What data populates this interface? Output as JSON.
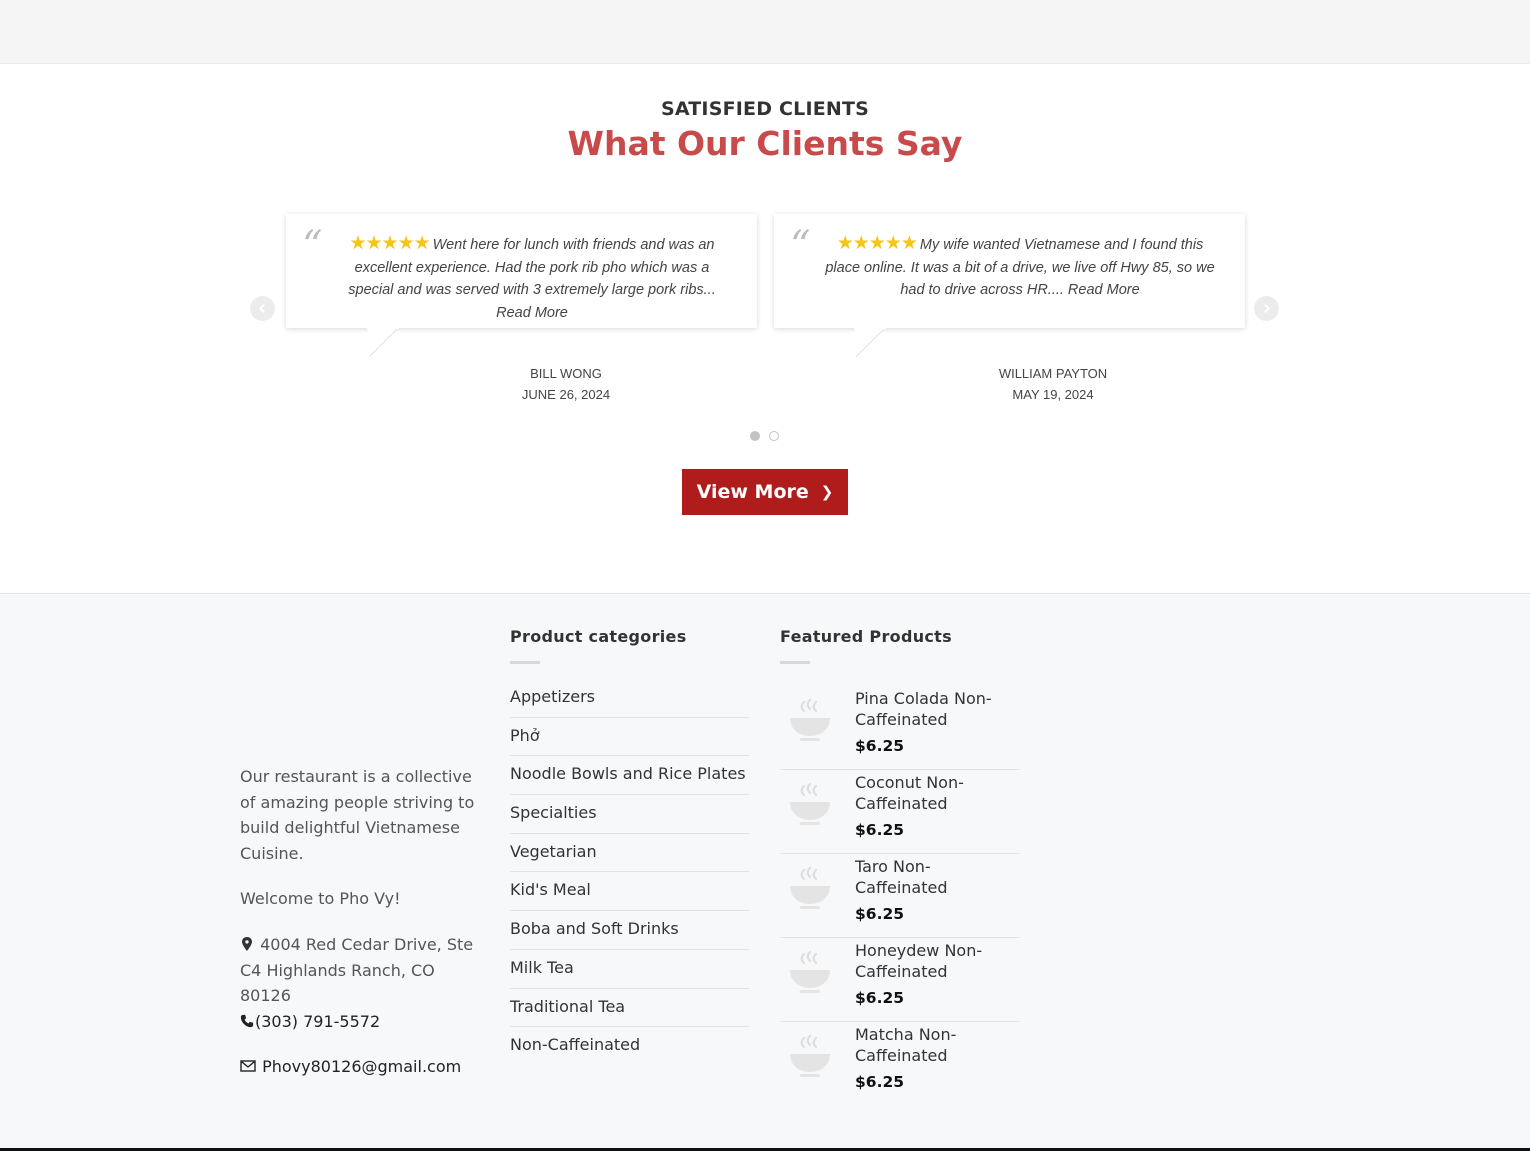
{
  "testimonials": {
    "eyebrow": "SATISFIED CLIENTS",
    "heading": "What Our Clients Say",
    "reviews": [
      {
        "stars": "★★★★★",
        "rating": 5,
        "text": "Went here for lunch with friends and was an excellent experience. Had the pork rib pho which was a special and was served with 3 extremely large pork ribs... Read More",
        "author": "BILL WONG",
        "date": "JUNE 26, 2024"
      },
      {
        "stars": "★★★★★",
        "rating": 5,
        "text": "My wife wanted Vietnamese and I found this place online. It was a bit of a drive, we live off Hwy 85, so we had to drive across HR.... Read More",
        "author": "WILLIAM PAYTON",
        "date": "MAY 19, 2024"
      }
    ],
    "carousel": {
      "pages": 2,
      "active_page": 1
    },
    "view_more_label": "View More"
  },
  "footer": {
    "about": {
      "description": "Our restaurant is a collective of amazing people striving to build delightful Vietnamese Cuisine.",
      "welcome": "Welcome to Pho Vy!",
      "address": "4004 Red Cedar Drive, Ste C4 Highlands Ranch, CO 80126",
      "phone": "(303) 791-5572",
      "email": "Phovy80126@gmail.com"
    },
    "categories": {
      "title": "Product categories",
      "items": [
        "Appetizers",
        "Phở",
        "Noodle Bowls and Rice Plates",
        "Specialties",
        "Vegetarian",
        "Kid's Meal",
        "Boba and Soft Drinks",
        "Milk Tea",
        "Traditional Tea",
        "Non-Caffeinated"
      ]
    },
    "featured": {
      "title": "Featured Products",
      "items": [
        {
          "name": "Pina Colada Non-Caffeinated",
          "price": "$6.25"
        },
        {
          "name": "Coconut Non-Caffeinated",
          "price": "$6.25"
        },
        {
          "name": "Taro Non-Caffeinated",
          "price": "$6.25"
        },
        {
          "name": "Honeydew Non-Caffeinated",
          "price": "$6.25"
        },
        {
          "name": "Matcha Non-Caffeinated",
          "price": "$6.25"
        }
      ]
    }
  },
  "colors": {
    "accent_heading": "#c94a4a",
    "button": "#b01c1c",
    "star": "#f5c518"
  },
  "icons": [
    "quote-icon",
    "star-icon",
    "chevron-left-icon",
    "chevron-right-icon",
    "map-pin-icon",
    "phone-icon",
    "envelope-icon",
    "bowl-placeholder-icon"
  ]
}
